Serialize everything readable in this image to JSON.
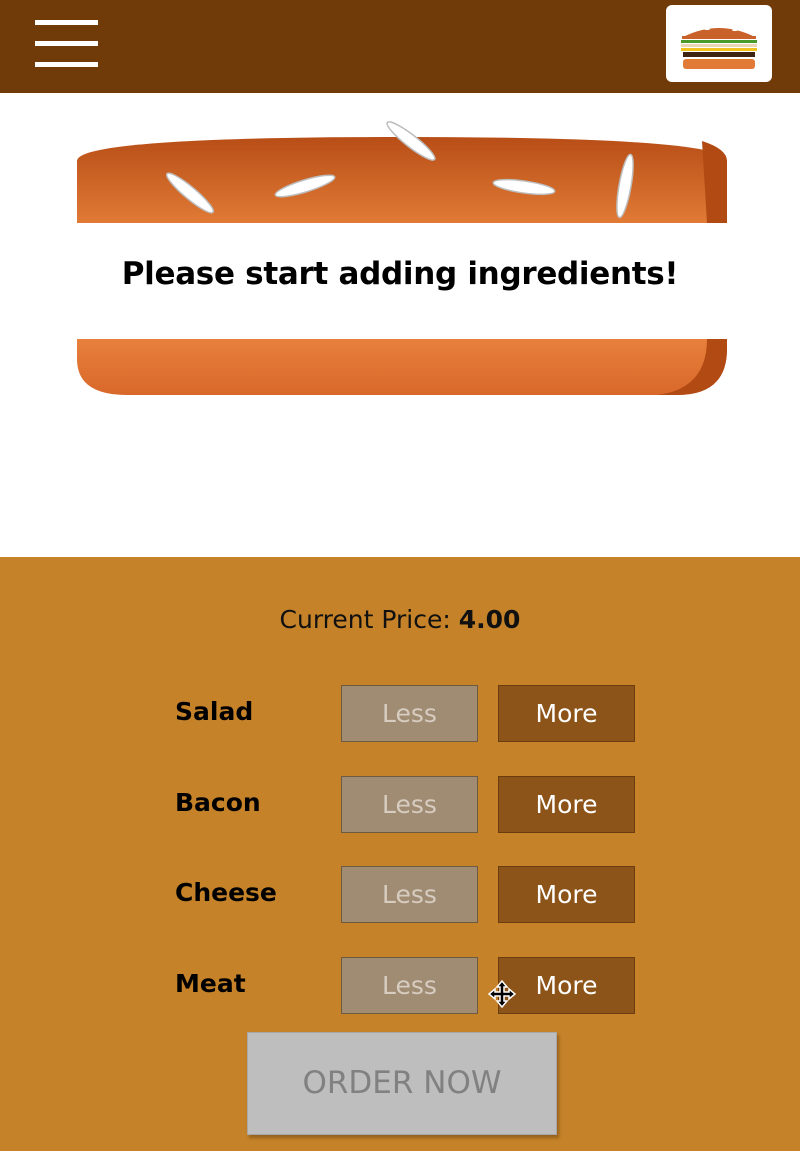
{
  "toolbar": {
    "menu_icon": "hamburger-menu-icon",
    "logo_icon": "burger-logo-icon"
  },
  "burger": {
    "message": "Please start adding ingredients!",
    "colors": {
      "bread_top": "#C75B1E",
      "bread_bottom": "#E07A35",
      "seeds": "#ffffff"
    }
  },
  "controls": {
    "price_label": "Current Price:",
    "price_value": "4.00",
    "less_label": "Less",
    "more_label": "More",
    "ingredients": [
      {
        "label": "Salad"
      },
      {
        "label": "Bacon"
      },
      {
        "label": "Cheese"
      },
      {
        "label": "Meat"
      }
    ],
    "order_label": "ORDER NOW"
  },
  "colors": {
    "toolbar": "#703B09",
    "controls_bg": "#C58228",
    "less_button": "#A08B73",
    "more_button": "#8C5418",
    "order_button_disabled": "#BFBEBF"
  }
}
